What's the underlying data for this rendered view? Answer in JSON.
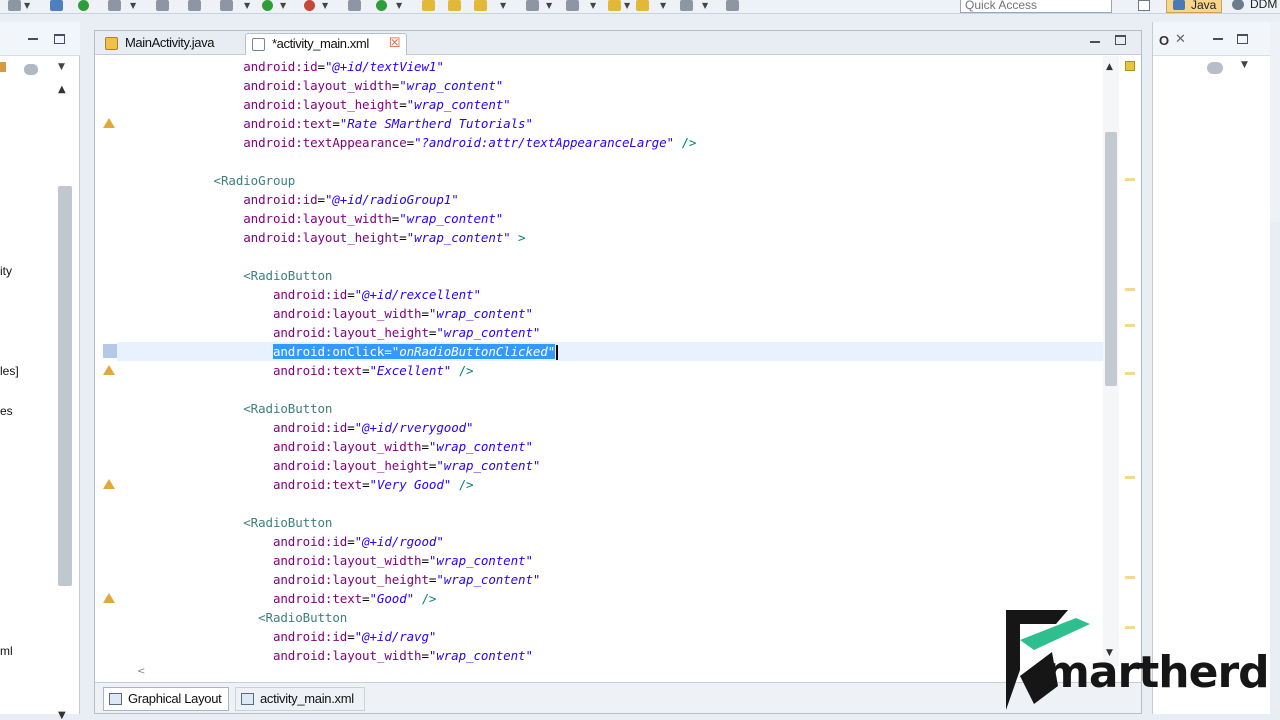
{
  "toolbar": {
    "quick_access_placeholder": "Quick Access",
    "perspectives": [
      {
        "label": "Java",
        "active": true
      },
      {
        "label": "DDM",
        "active": false
      }
    ]
  },
  "left_panel": {
    "fragments": [
      "ity",
      "les]",
      "es",
      "ml"
    ]
  },
  "editor": {
    "tabs": [
      {
        "label": "MainActivity.java",
        "active": false,
        "icon": "java-file-icon"
      },
      {
        "label": "*activity_main.xml",
        "active": true,
        "icon": "xml-file-icon",
        "close": "☒"
      }
    ],
    "bottom_tabs": [
      {
        "label": "Graphical Layout",
        "active": true
      },
      {
        "label": "activity_main.xml",
        "active": false
      }
    ],
    "lines": [
      {
        "indent": "        ",
        "attr": "android:id",
        "val": "\"@+id/textView1\"",
        "tail": ""
      },
      {
        "indent": "        ",
        "attr": "android:layout_width",
        "val": "\"wrap_content\"",
        "tail": ""
      },
      {
        "indent": "        ",
        "attr": "android:layout_height",
        "val": "\"wrap_content\"",
        "tail": ""
      },
      {
        "indent": "        ",
        "attr": "android:text",
        "val": "\"Rate SMartherd Tutorials\"",
        "tail": ""
      },
      {
        "indent": "        ",
        "attr": "android:textAppearance",
        "val": "\"?android:attr/textAppearanceLarge\"",
        "tail": " />"
      },
      {
        "indent": "",
        "attr": "",
        "val": "",
        "tail": ""
      },
      {
        "indent": "    ",
        "tag": "<RadioGroup"
      },
      {
        "indent": "        ",
        "attr": "android:id",
        "val": "\"@+id/radioGroup1\"",
        "tail": ""
      },
      {
        "indent": "        ",
        "attr": "android:layout_width",
        "val": "\"wrap_content\"",
        "tail": ""
      },
      {
        "indent": "        ",
        "attr": "android:layout_height",
        "val": "\"wrap_content\"",
        "tail": " >"
      },
      {
        "indent": "",
        "attr": "",
        "val": "",
        "tail": ""
      },
      {
        "indent": "        ",
        "tag": "<RadioButton"
      },
      {
        "indent": "            ",
        "attr": "android:id",
        "val": "\"@+id/rexcellent\"",
        "tail": ""
      },
      {
        "indent": "            ",
        "attr": "android:layout_width",
        "val": "\"wrap_content\"",
        "tail": ""
      },
      {
        "indent": "            ",
        "attr": "android:layout_height",
        "val": "\"wrap_content\"",
        "tail": ""
      },
      {
        "indent": "            ",
        "attr": "android:onClick",
        "val": "\"onRadioButtonClicked\"",
        "tail": "",
        "selected": true
      },
      {
        "indent": "            ",
        "attr": "android:text",
        "val": "\"Excellent\"",
        "tail": " />"
      },
      {
        "indent": "",
        "attr": "",
        "val": "",
        "tail": ""
      },
      {
        "indent": "        ",
        "tag": "<RadioButton"
      },
      {
        "indent": "            ",
        "attr": "android:id",
        "val": "\"@+id/rverygood\"",
        "tail": ""
      },
      {
        "indent": "            ",
        "attr": "android:layout_width",
        "val": "\"wrap_content\"",
        "tail": ""
      },
      {
        "indent": "            ",
        "attr": "android:layout_height",
        "val": "\"wrap_content\"",
        "tail": ""
      },
      {
        "indent": "            ",
        "attr": "android:text",
        "val": "\"Very Good\"",
        "tail": " />"
      },
      {
        "indent": "",
        "attr": "",
        "val": "",
        "tail": ""
      },
      {
        "indent": "        ",
        "tag": "<RadioButton"
      },
      {
        "indent": "            ",
        "attr": "android:id",
        "val": "\"@+id/rgood\"",
        "tail": ""
      },
      {
        "indent": "            ",
        "attr": "android:layout_width",
        "val": "\"wrap_content\"",
        "tail": ""
      },
      {
        "indent": "            ",
        "attr": "android:layout_height",
        "val": "\"wrap_content\"",
        "tail": ""
      },
      {
        "indent": "            ",
        "attr": "android:text",
        "val": "\"Good\"",
        "tail": " />"
      },
      {
        "indent": "          ",
        "tag": "<RadioButton"
      },
      {
        "indent": "            ",
        "attr": "android:id",
        "val": "\"@+id/ravg\"",
        "tail": ""
      },
      {
        "indent": "            ",
        "attr": "android:layout_width",
        "val": "\"wrap_content\"",
        "tail": ""
      }
    ],
    "warning_lines": [
      3,
      16,
      22,
      28
    ],
    "current_line": 15
  },
  "logo": {
    "text": "martherd",
    "brand_color": "#2fbf8f"
  },
  "colors": {
    "selection": "#3399ff",
    "attr": "#7f007f",
    "value": "#2a00ff",
    "tag": "#3f7f7f"
  }
}
